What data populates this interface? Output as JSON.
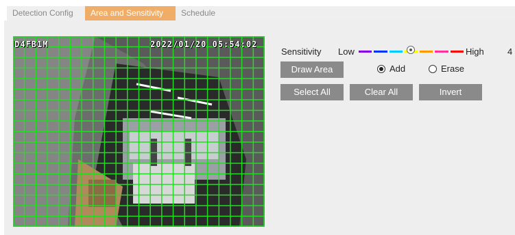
{
  "tabs": [
    {
      "label": "Detection Config"
    },
    {
      "label": "Area and Sensitivity"
    },
    {
      "label": "Schedule"
    }
  ],
  "video": {
    "camera_name": "D4FB1M",
    "timestamp": "2022/01/20 05:54:02"
  },
  "sensitivity": {
    "label": "Sensitivity",
    "low_label": "Low",
    "high_label": "High",
    "value": "4",
    "slider_level": 0.5,
    "colors": [
      "#8a00e6",
      "#0033ff",
      "#00ccff",
      "#ffff00",
      "#ff9900",
      "#ff3399",
      "#ff0000"
    ]
  },
  "controls": {
    "draw_area": "Draw Area",
    "add": "Add",
    "erase": "Erase",
    "select_all": "Select All",
    "clear_all": "Clear All",
    "invert": "Invert",
    "mode_selected": "add"
  },
  "colors": {
    "active_tab": "#f0ad68",
    "grid": "#22dd22",
    "button": "#8a8a8a"
  }
}
